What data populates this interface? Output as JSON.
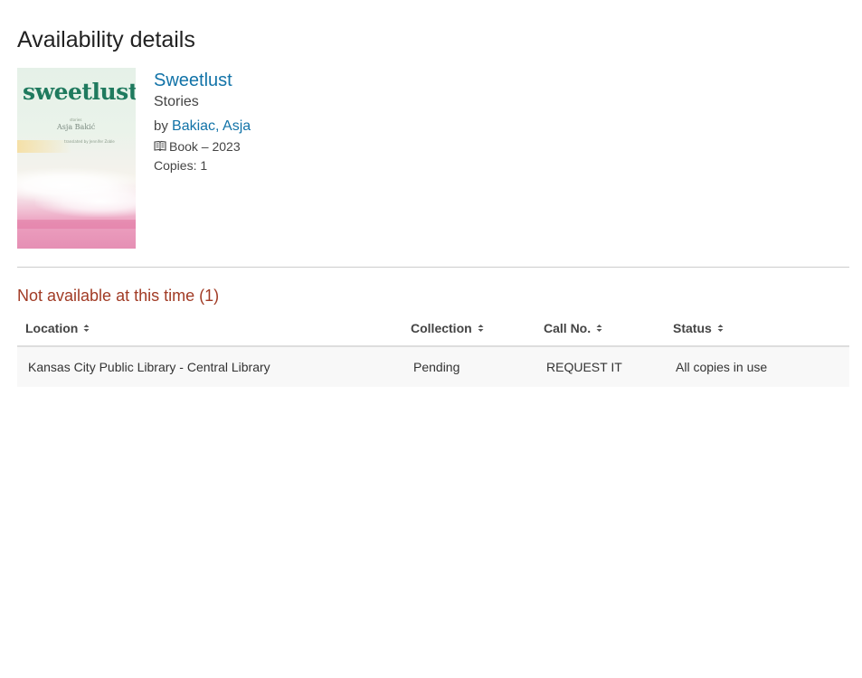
{
  "page": {
    "title": "Availability details"
  },
  "item": {
    "cover": {
      "title_text": "sweetlust",
      "author_text": "Asja Bakić",
      "small_text_1": "stories",
      "small_text_2": "translated by Jennifer Zoble"
    },
    "title": "Sweetlust",
    "subtitle": "Stories",
    "by_label": "by",
    "author": "Bakiac, Asja",
    "format_icon": "book-icon",
    "format": "Book – 2023",
    "copies": "Copies: 1"
  },
  "availability": {
    "heading": "Not available at this time (1)",
    "columns": [
      "Location",
      "Collection",
      "Call No.",
      "Status"
    ],
    "rows": [
      {
        "location": "Kansas City Public Library - Central Library",
        "collection": "Pending",
        "call_no": "REQUEST IT",
        "status": "All copies in use"
      }
    ]
  },
  "colors": {
    "link": "#1273a8",
    "unavailable_heading": "#a13b25"
  }
}
